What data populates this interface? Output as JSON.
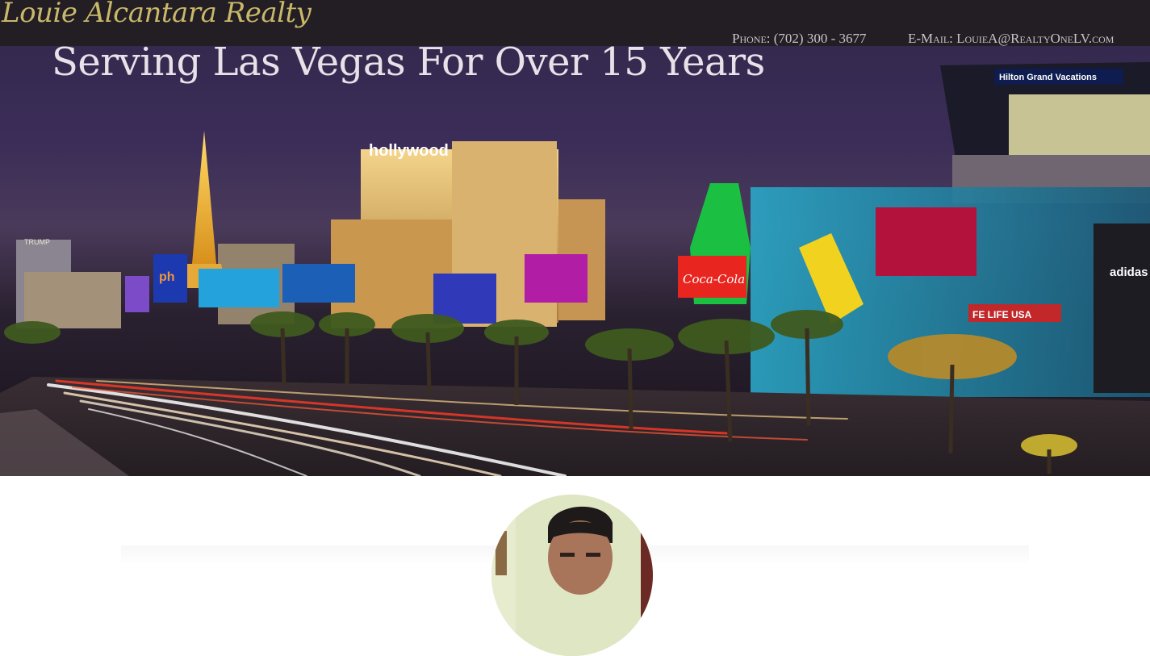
{
  "site": {
    "logo_text": "Louie Alcantara Realty"
  },
  "header": {
    "phone": "Phone: (702) 300 - 3677",
    "email": "E-Mail: LouieA@RealtyOneLV.com"
  },
  "hero": {
    "title": "Serving Las Vegas For Over 15 Years",
    "sign_hollywood": "hollywood",
    "sign_hilton": "Hilton Grand Vacations",
    "sign_trump": "TRUMP",
    "sign_adidas": "adidas",
    "sign_ph": "ph",
    "sign_coca": "Coca-Cola",
    "sign_lifeusa": "FE LIFE USA"
  },
  "colors": {
    "header_bg": "#221e24",
    "logo_gold": "#c9b86a",
    "contact_text": "#c9c6c9",
    "title_text": "#e6e2e8"
  },
  "profile": {
    "alt": "agent-portrait"
  }
}
